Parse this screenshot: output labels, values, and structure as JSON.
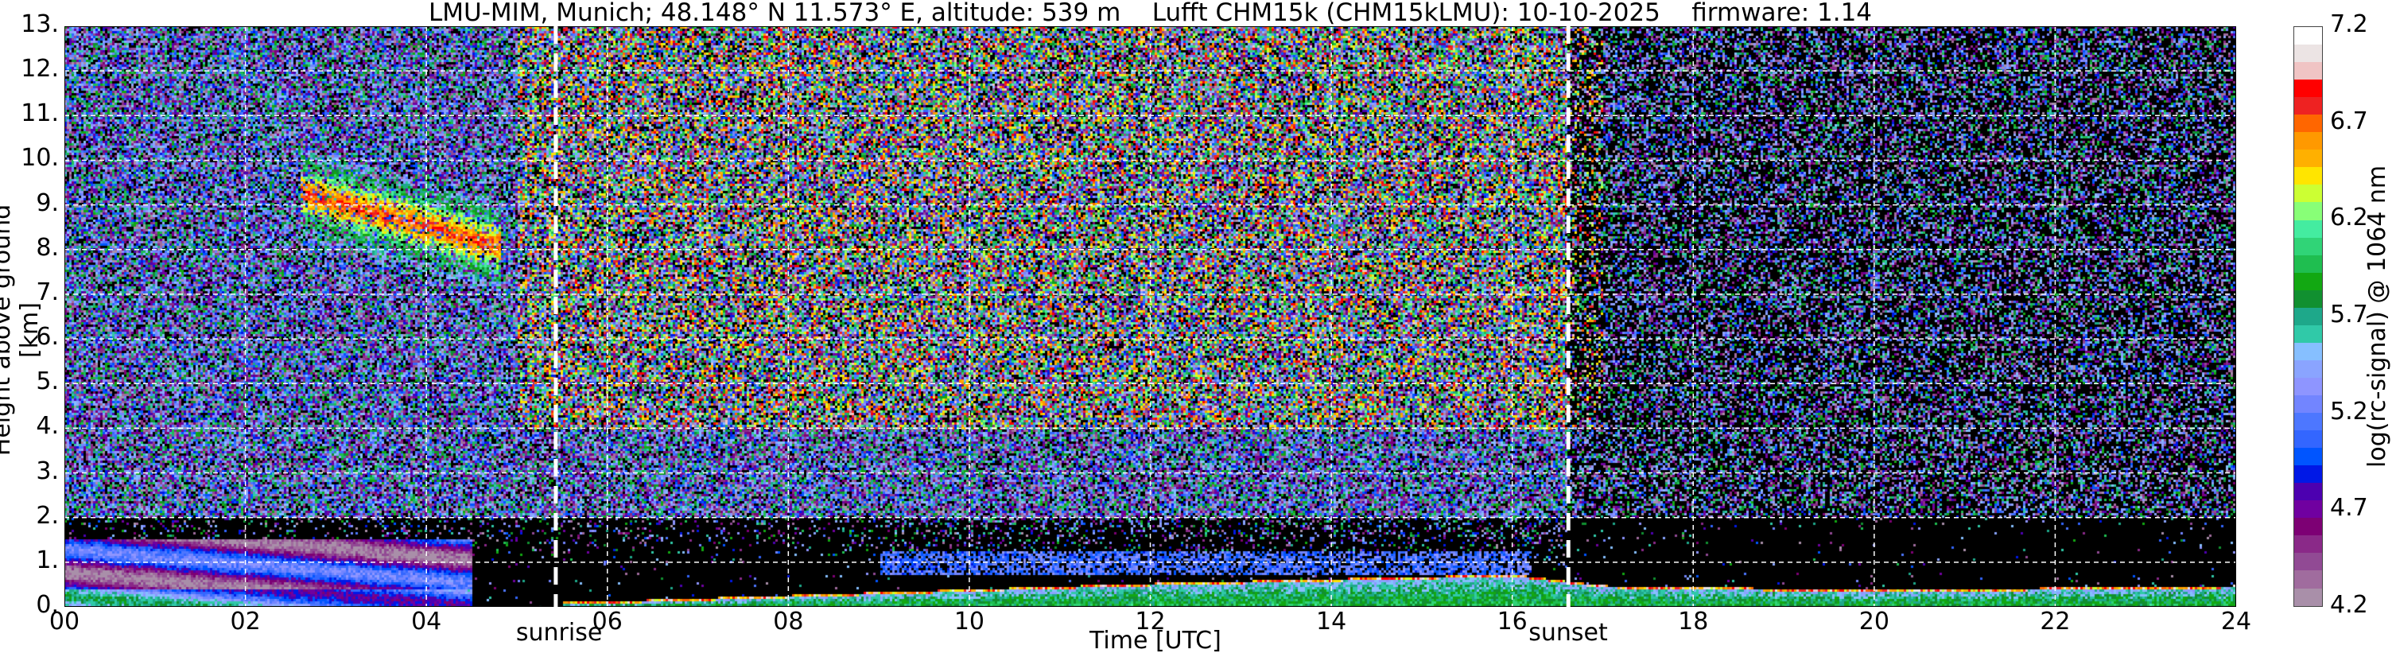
{
  "chart_data": {
    "type": "heatmap",
    "title": "LMU-MIM, Munich; 48.148° N 11.573° E, altitude: 539 m    Lufft CHM15k (CHM15kLMU): 10-10-2025    firmware: 1.14",
    "xlabel": "Time [UTC]",
    "ylabel": "Height above ground [km]",
    "xlim": [
      0,
      24
    ],
    "ylim": [
      0,
      13
    ],
    "x_ticks": [
      "00",
      "02",
      "04",
      "06",
      "08",
      "10",
      "12",
      "14",
      "16",
      "18",
      "20",
      "22",
      "24"
    ],
    "y_ticks": [
      "0.",
      "1.",
      "2.",
      "3.",
      "4.",
      "5.",
      "6.",
      "7.",
      "8.",
      "9.",
      "10.",
      "11.",
      "12.",
      "13."
    ],
    "grid": true,
    "colorbar": {
      "label": "log(rc-signal) @ 1064 nm",
      "range": [
        4.2,
        7.2
      ],
      "ticks": [
        "4.2",
        "4.7",
        "5.2",
        "5.7",
        "6.2",
        "6.7",
        "7.2"
      ],
      "colors": [
        "#a98fa9",
        "#a06c9e",
        "#914a94",
        "#8a2988",
        "#7d0074",
        "#7000a0",
        "#4c00b0",
        "#0018e6",
        "#0055ff",
        "#3366ff",
        "#4d77ff",
        "#7285ff",
        "#8e95ff",
        "#8aa4ff",
        "#86bfff",
        "#30c9a8",
        "#1ea88a",
        "#119030",
        "#12a812",
        "#1fbe50",
        "#30d477",
        "#44eca0",
        "#88ff77",
        "#ccff33",
        "#ffe500",
        "#ffb000",
        "#ff9900",
        "#ff6600",
        "#ee2222",
        "#ff0000",
        "#f0c4c4",
        "#ece4e4",
        "#ffffff"
      ]
    },
    "annotations": [
      {
        "label": "sunrise",
        "x": 5.43,
        "style": "white dashed vertical line"
      },
      {
        "label": "sunset",
        "x": 16.62,
        "style": "white dashed vertical line"
      }
    ],
    "features": [
      {
        "kind": "cloud",
        "x_range": [
          2.6,
          4.8
        ],
        "y_range": [
          7.8,
          10.8
        ],
        "peak_value": 6.3
      },
      {
        "kind": "residual layer",
        "x_range": [
          0,
          4.5
        ],
        "y_range": [
          0,
          1.55
        ],
        "value": 5.0
      },
      {
        "kind": "aerosol layer",
        "x_range": [
          9,
          16.2
        ],
        "y_range": [
          0.7,
          1.3
        ],
        "value": 5.2
      },
      {
        "kind": "boundary layer top",
        "x": [
          6,
          9,
          12,
          14,
          16,
          17,
          20,
          24
        ],
        "y": [
          0.1,
          0.3,
          0.5,
          0.6,
          0.7,
          0.45,
          0.35,
          0.45
        ]
      }
    ]
  }
}
